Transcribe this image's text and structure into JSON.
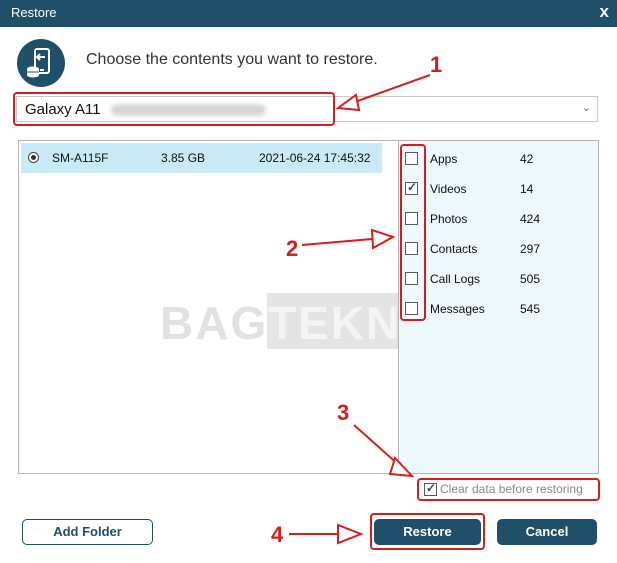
{
  "window": {
    "title": "Restore",
    "close_symbol": "x"
  },
  "header": {
    "icon": "phone-restore-icon",
    "text": "Choose the contents you want to restore."
  },
  "device_select": {
    "value": "Galaxy A11"
  },
  "backups": [
    {
      "model": "SM-A115F",
      "size": "3.85 GB",
      "date": "2021-06-24 17:45:32",
      "selected": true
    }
  ],
  "content_types": [
    {
      "label": "Apps",
      "count": "42",
      "checked": false
    },
    {
      "label": "Videos",
      "count": "14",
      "checked": true
    },
    {
      "label": "Photos",
      "count": "424",
      "checked": false
    },
    {
      "label": "Contacts",
      "count": "297",
      "checked": false
    },
    {
      "label": "Call Logs",
      "count": "505",
      "checked": false
    },
    {
      "label": "Messages",
      "count": "545",
      "checked": false
    }
  ],
  "clear_data": {
    "label": "Clear data before restoring",
    "checked": true
  },
  "buttons": {
    "add_folder": "Add Folder",
    "restore": "Restore",
    "cancel": "Cancel"
  },
  "annotations": {
    "n1": "1",
    "n2": "2",
    "n3": "3",
    "n4": "4"
  },
  "watermark": {
    "part1": "BAGI",
    "part2": "TEKNO"
  },
  "colors": {
    "accent": "#1f4f69",
    "annotation": "#d51d1d",
    "selection": "#c8ebf7"
  }
}
